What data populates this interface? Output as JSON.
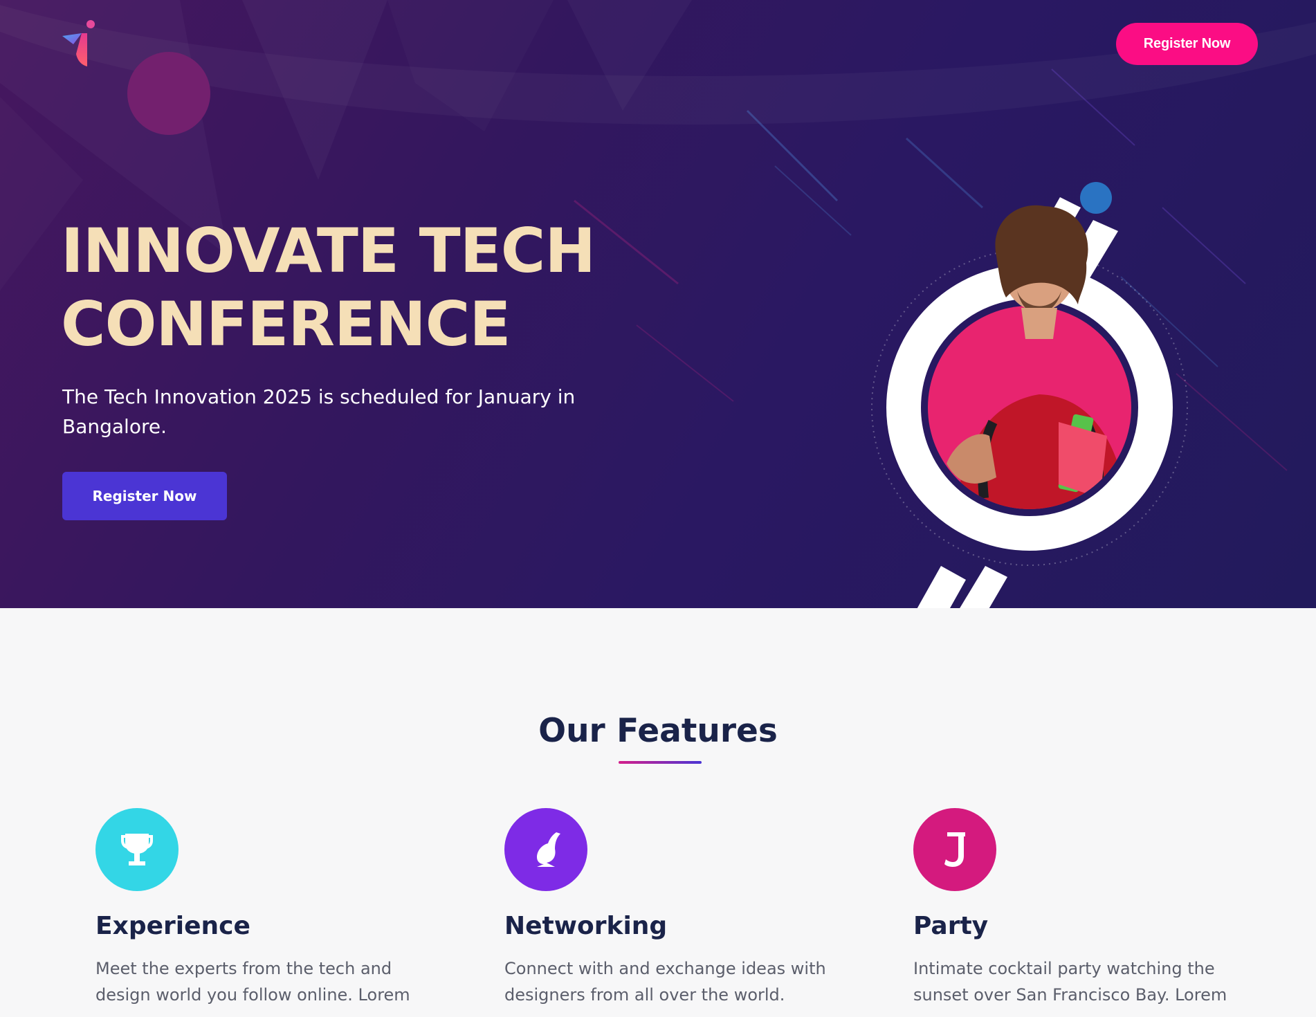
{
  "header": {
    "register_label": "Register Now"
  },
  "hero": {
    "title_line1": "INNOVATE TECH",
    "title_line2": "CONFERENCE",
    "subtitle": "The Tech Innovation 2025 is scheduled for January in Bangalore.",
    "register_label": "Register Now"
  },
  "features": {
    "title": "Our Features",
    "items": [
      {
        "title": "Experience",
        "description": "Meet the experts from the tech and design world you follow online. Lorem",
        "icon": "trophy-icon",
        "color": "#33d6e6"
      },
      {
        "title": "Networking",
        "description": "Connect with and exchange ideas with designers from all over the world.",
        "icon": "bird-icon",
        "color": "#7e2be6"
      },
      {
        "title": "Party",
        "description": "Intimate cocktail party watching the sunset over San Francisco Bay. Lorem",
        "icon": "letter-j-icon",
        "color": "#d41a7e"
      }
    ]
  },
  "colors": {
    "accent_pink": "#fb0d84",
    "accent_indigo": "#4b35d4",
    "title_cream": "#f5dfb7",
    "heading_navy": "#1a2349"
  }
}
